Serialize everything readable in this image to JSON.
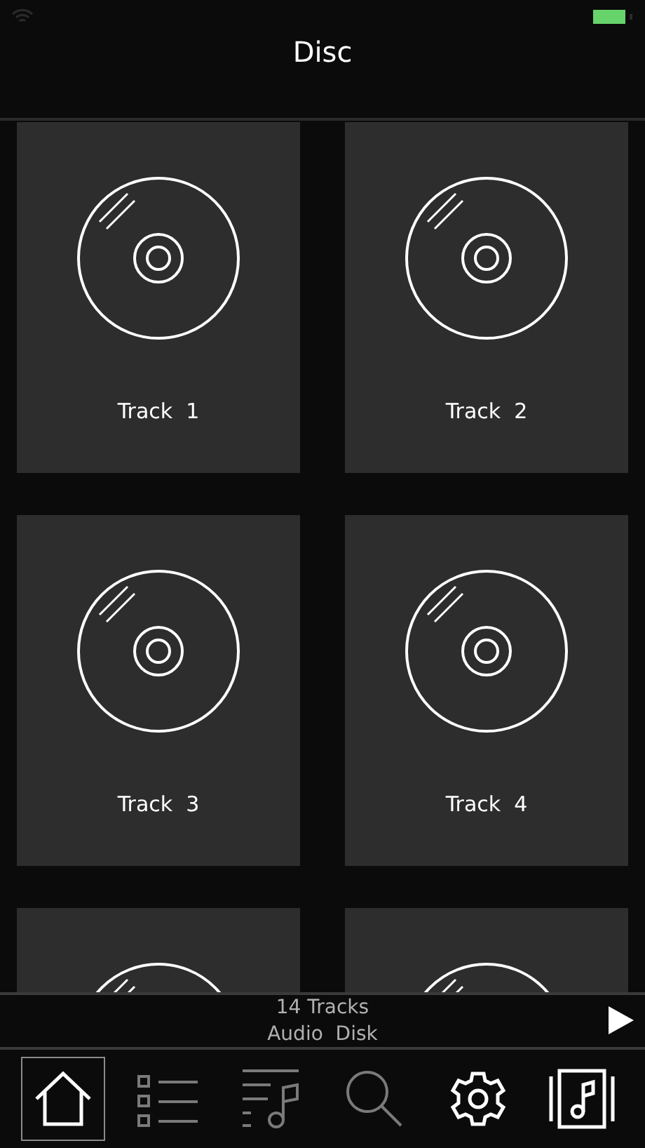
{
  "header": {
    "title": "Disc"
  },
  "tracks": [
    {
      "kind": "disc",
      "title": "Track  1"
    },
    {
      "kind": "disc",
      "title": "Track  2"
    },
    {
      "kind": "disc",
      "title": "Track  3"
    },
    {
      "kind": "disc",
      "title": "Track  4"
    },
    {
      "kind": "disc"
    },
    {
      "kind": "disc"
    }
  ],
  "now_playing": {
    "line_1": "14 Tracks",
    "line_2": "Audio  Disk",
    "play": true
  },
  "tab_bar": [
    {
      "kind": "home",
      "selected": true,
      "disabled": false
    },
    {
      "kind": "list",
      "selected": false,
      "disabled": true
    },
    {
      "kind": "playlist",
      "selected": false,
      "disabled": true
    },
    {
      "kind": "search",
      "selected": false,
      "disabled": true
    },
    {
      "kind": "settings",
      "selected": false,
      "disabled": false
    },
    {
      "kind": "album",
      "selected": false,
      "disabled": false
    }
  ]
}
